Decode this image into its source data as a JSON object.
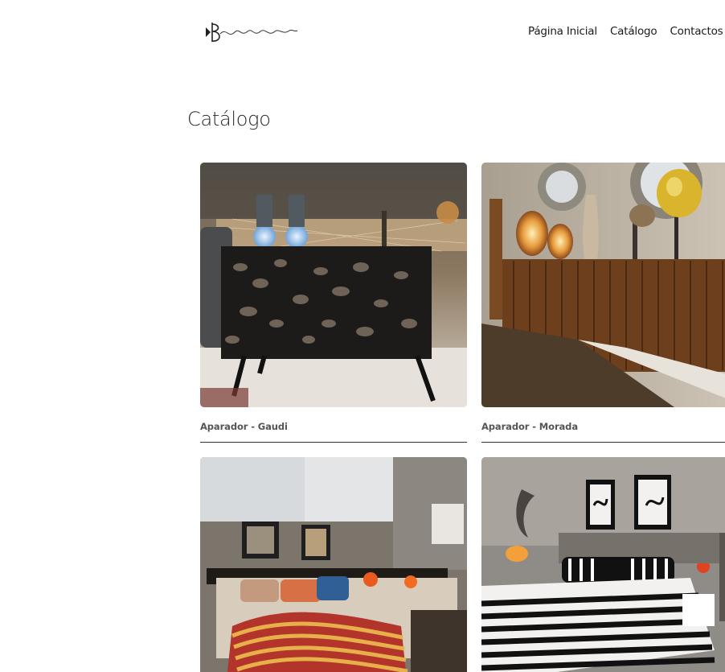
{
  "header": {
    "logo_icon": "b-interiores-logo",
    "logo_text": "interiores",
    "nav": [
      {
        "label": "Página Inicial"
      },
      {
        "label": "Catálogo"
      },
      {
        "label": "Contactos"
      }
    ]
  },
  "main": {
    "title": "Catálogo",
    "products": [
      {
        "name": "Aparador - Gaudi",
        "image_icon": "sideboard-photo"
      },
      {
        "name": "Aparador - Morada",
        "image_icon": "sideboard-photo"
      },
      {
        "name": "",
        "image_icon": "bedroom-photo"
      },
      {
        "name": "",
        "image_icon": "bedroom-photo"
      }
    ]
  },
  "colors": {
    "text": "#1a1a1a",
    "caption": "#555555",
    "divider": "#333333"
  }
}
